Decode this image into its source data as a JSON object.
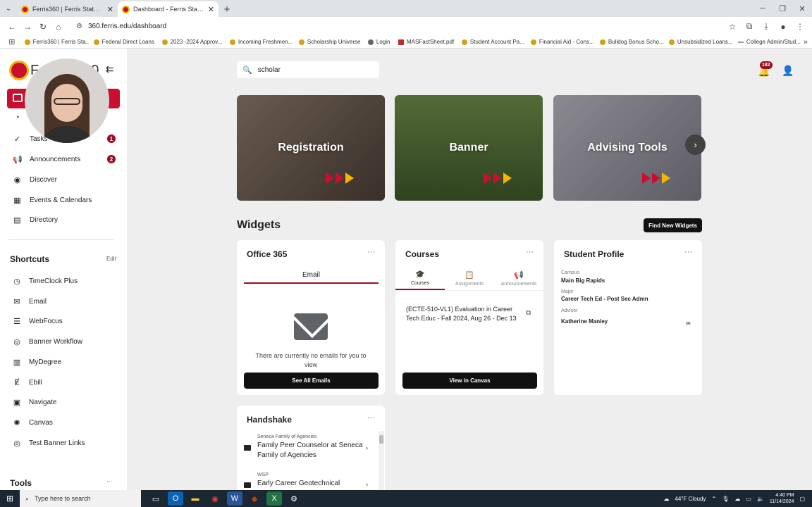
{
  "browser": {
    "tabs": [
      {
        "title": "Ferris360 | Ferris State University",
        "active": false
      },
      {
        "title": "Dashboard - Ferris State University",
        "active": true
      }
    ],
    "url": "360.ferris.edu/dashboard",
    "bookmarks": [
      {
        "label": "Ferris360 | Ferris Sta...",
        "icon": "ferris-icon"
      },
      {
        "label": "Federal Direct Loans",
        "icon": "ferris-icon"
      },
      {
        "label": "2023 -2024 Approv...",
        "icon": "ferris-icon"
      },
      {
        "label": "Incoming Freshmen...",
        "icon": "ferris-icon"
      },
      {
        "label": "Scholarship Universe",
        "icon": "ferris-icon"
      },
      {
        "label": "Login",
        "icon": "globe-icon"
      },
      {
        "label": "MASFactSheet.pdf",
        "icon": "pdf-icon"
      },
      {
        "label": "Student Account Pa...",
        "icon": "ferris-icon"
      },
      {
        "label": "Financial Aid - Cons...",
        "icon": "ferris-icon"
      },
      {
        "label": "Bulldog Bonus Scho...",
        "icon": "ferris-icon"
      },
      {
        "label": "Unsubsidized Loans...",
        "icon": "ferris-icon"
      },
      {
        "label": "College Admin/Stud...",
        "icon": "line-icon"
      }
    ]
  },
  "sidebar": {
    "logo_text": "F",
    "logo_suffix": "0",
    "nav": [
      {
        "label": "Tasks",
        "icon": "check-circle-icon",
        "badge": "1"
      },
      {
        "label": "Announcements",
        "icon": "megaphone-icon",
        "badge": "2"
      },
      {
        "label": "Discover",
        "icon": "compass-icon"
      },
      {
        "label": "Events & Calendars",
        "icon": "calendar-icon"
      },
      {
        "label": "Directory",
        "icon": "contacts-icon"
      }
    ],
    "shortcuts_title": "Shortcuts",
    "shortcuts_edit": "Edit",
    "shortcuts": [
      {
        "label": "TimeClock Plus",
        "icon": "clock-icon"
      },
      {
        "label": "Email",
        "icon": "envelope-icon"
      },
      {
        "label": "WebFocus",
        "icon": "list-icon"
      },
      {
        "label": "Banner Workflow",
        "icon": "banner-icon"
      },
      {
        "label": "MyDegree",
        "icon": "degree-icon"
      },
      {
        "label": "Ebill",
        "icon": "ebill-icon"
      },
      {
        "label": "Navigate",
        "icon": "navigate-icon"
      },
      {
        "label": "Canvas",
        "icon": "canvas-icon"
      },
      {
        "label": "Test Banner Links",
        "icon": "banner-icon"
      }
    ],
    "tools_title": "Tools",
    "tools_more": "···"
  },
  "header": {
    "search_value": "scholar",
    "notification_count": "182"
  },
  "carousel": [
    {
      "label": "Registration",
      "color": "#7a6a5e"
    },
    {
      "label": "Banner",
      "color": "#5d7a3f"
    },
    {
      "label": "Advising Tools",
      "color": "#9a9aa6"
    }
  ],
  "widgets": {
    "title": "Widgets",
    "find_button": "Find New Widgets",
    "office365": {
      "title": "Office 365",
      "menu": "···",
      "tab": "Email",
      "empty_message": "There are currently no emails for you to view",
      "button": "See All Emails"
    },
    "courses": {
      "title": "Courses",
      "menu": "···",
      "tabs": [
        "Courses",
        "Assignments",
        "Announcements"
      ],
      "course": "(ECTE-510-VL1) Evaluation in Career Tech Educ - Fall 2024, Aug 26 - Dec 13",
      "button": "View in Canvas"
    },
    "student_profile": {
      "title": "Student Profile",
      "menu": "···",
      "campus_label": "Campus",
      "campus": "Main Big Rapids",
      "major_label": "Major",
      "major": "Career Tech Ed - Post Sec Admn",
      "advisor_label": "Advisor",
      "advisor": "Katherine Manley"
    },
    "handshake": {
      "title": "Handshake",
      "menu": "···",
      "items": [
        {
          "company": "Seneca Family of Agencies",
          "title": "Family Peer Counselor at Seneca Family of Agencies"
        },
        {
          "company": "WSP",
          "title": "Early Career Geotechnical"
        }
      ]
    }
  },
  "taskbar": {
    "search_placeholder": "Type here to search",
    "weather": "44°F  Cloudy",
    "time": "4:40 PM",
    "date": "11/14/2024"
  }
}
